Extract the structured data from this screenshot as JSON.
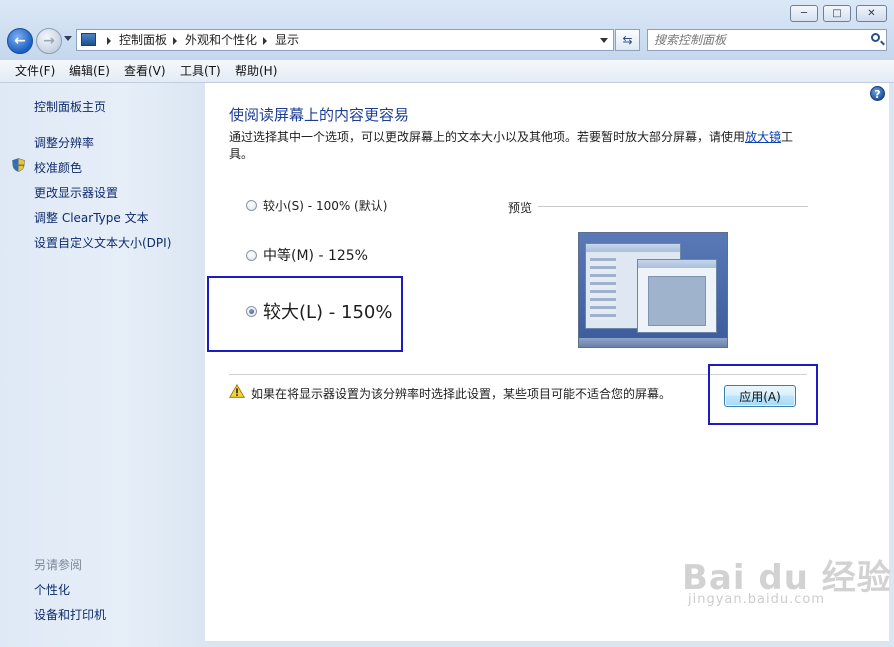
{
  "window": {
    "minimize_glyph": "─",
    "maximize_glyph": "□",
    "close_glyph": "✕"
  },
  "address": {
    "crumbs": [
      "控制面板",
      "外观和个性化",
      "显示"
    ]
  },
  "search": {
    "placeholder": "搜索控制面板"
  },
  "menu": [
    "文件(F)",
    "编辑(E)",
    "查看(V)",
    "工具(T)",
    "帮助(H)"
  ],
  "sidebar": {
    "links": [
      "控制面板主页",
      "调整分辨率",
      "校准颜色",
      "更改显示器设置",
      "调整 ClearType 文本",
      "设置自定义文本大小(DPI)"
    ],
    "see_also_title": "另请参阅",
    "see_also": [
      "个性化",
      "设备和打印机"
    ]
  },
  "main": {
    "heading": "使阅读屏幕上的内容更容易",
    "desc_prefix": "通过选择其中一个选项，可以更改屏幕上的文本大小以及其他项。若要暂时放大部分屏幕，请使用",
    "desc_link": "放大镜",
    "desc_suffix": "工具。",
    "options": [
      {
        "label": "较小(S) - 100% (默认)",
        "checked": false
      },
      {
        "label": "中等(M) - 125%",
        "checked": false
      },
      {
        "label": "较大(L) - 150%",
        "checked": true
      }
    ],
    "preview_label": "预览",
    "warning": "如果在将显示器设置为该分辨率时选择此设置，某些项目可能不适合您的屏幕。",
    "apply_label": "应用(A)"
  },
  "watermark": {
    "brand": "Bai du 经验",
    "url": "jingyan.baidu.com"
  },
  "colors": {
    "accent": "#1c3f94",
    "link": "#0e2b6b",
    "highlight_box": "#1c1cc2"
  }
}
